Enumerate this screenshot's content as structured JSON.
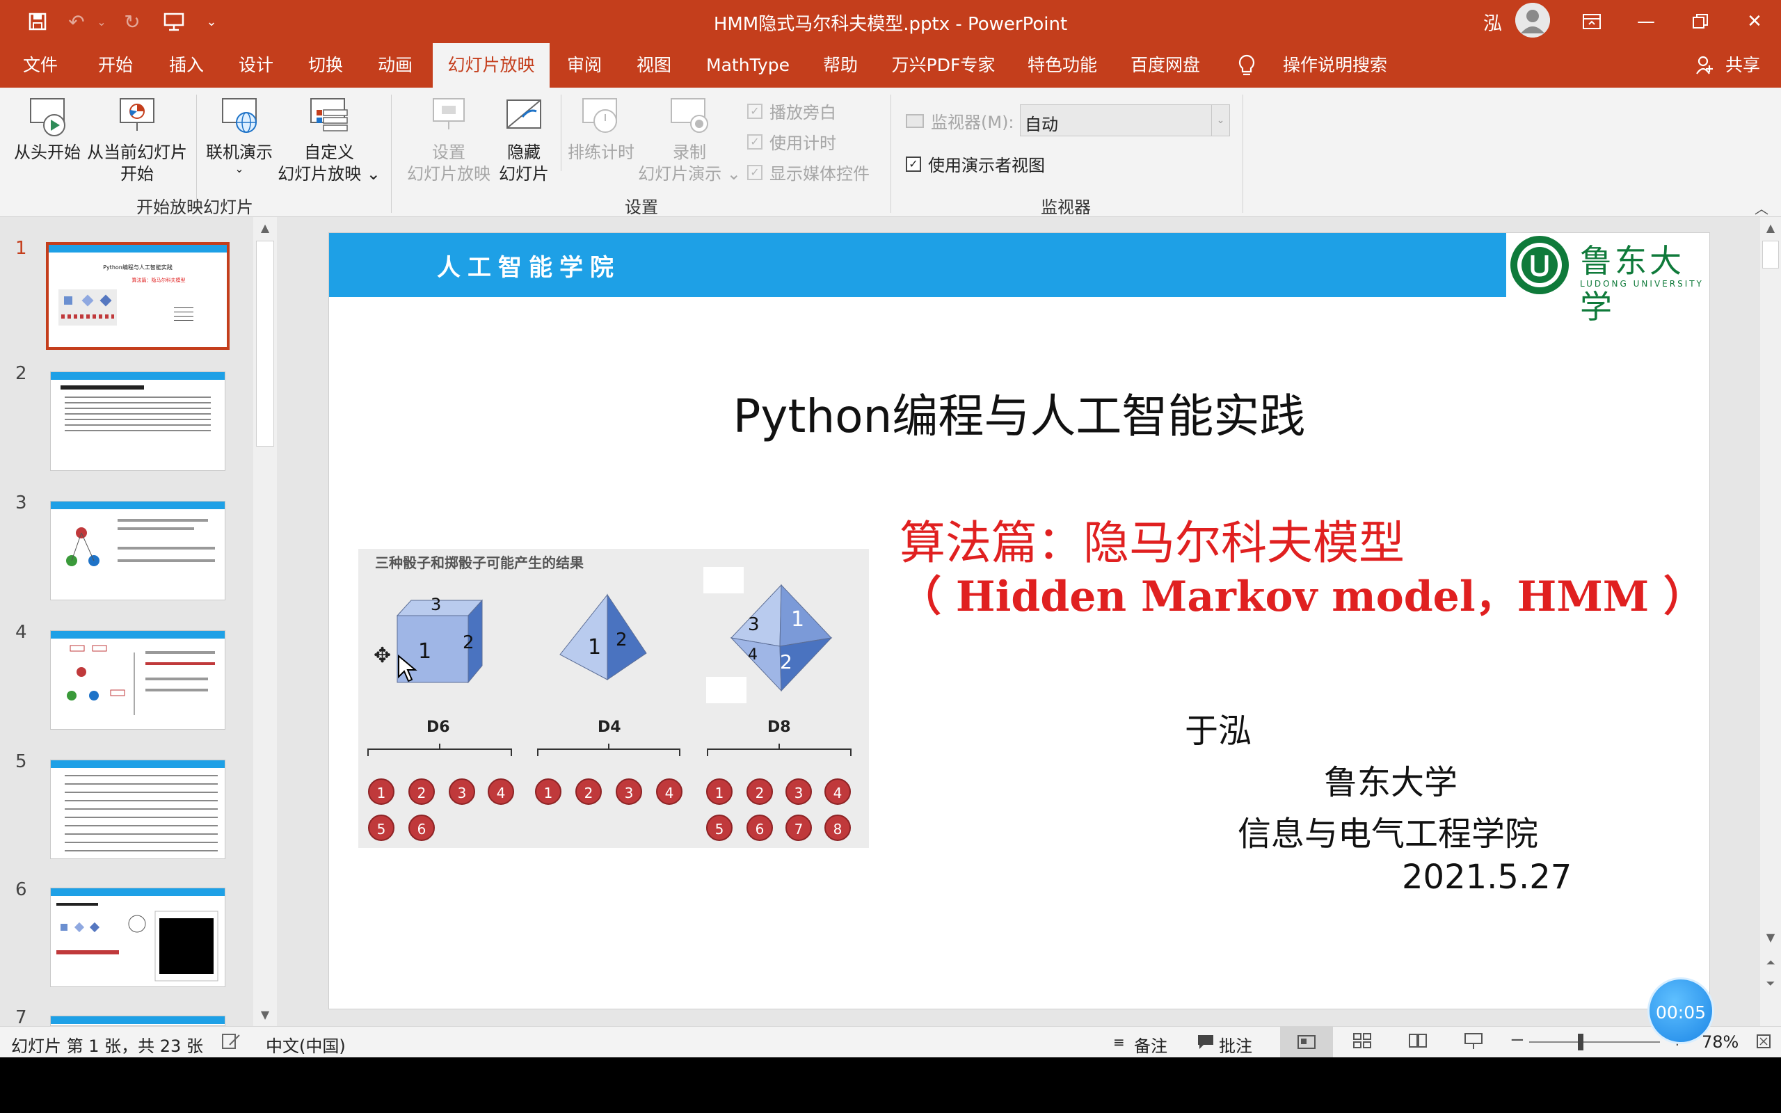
{
  "window": {
    "title": "HMM隐式马尔科夫模型.pptx  -  PowerPoint",
    "user": "泓"
  },
  "tabs": [
    {
      "label": "文件"
    },
    {
      "label": "开始"
    },
    {
      "label": "插入"
    },
    {
      "label": "设计"
    },
    {
      "label": "切换"
    },
    {
      "label": "动画"
    },
    {
      "label": "幻灯片放映",
      "active": true
    },
    {
      "label": "审阅"
    },
    {
      "label": "视图"
    },
    {
      "label": "MathType"
    },
    {
      "label": "帮助"
    },
    {
      "label": "万兴PDF专家"
    },
    {
      "label": "特色功能"
    },
    {
      "label": "百度网盘"
    }
  ],
  "tell_me": "操作说明搜索",
  "share": "共享",
  "ribbon": {
    "start": {
      "from_beginning": "从头开始",
      "from_current_1": "从当前幻灯片",
      "from_current_2": "开始",
      "online_1": "联机演示",
      "online_2": "⌄",
      "custom_1": "自定义",
      "custom_2": "幻灯片放映 ⌄",
      "group": "开始放映幻灯片"
    },
    "setup": {
      "setup_1": "设置",
      "setup_2": "幻灯片放映",
      "hide_1": "隐藏",
      "hide_2": "幻灯片",
      "rehearse": "排练计时",
      "record_1": "录制",
      "record_2": "幻灯片演示 ⌄",
      "play_narrations": "播放旁白",
      "use_timings": "使用计时",
      "show_media_controls": "显示媒体控件",
      "group": "设置"
    },
    "monitors": {
      "monitor_label": "监视器(M):",
      "monitor_value": "自动",
      "presenter_view": "使用演示者视图",
      "group": "监视器"
    }
  },
  "thumbnails": [
    "1",
    "2",
    "3",
    "4",
    "5",
    "6",
    "7"
  ],
  "slide": {
    "college": "人工智能学院",
    "university": "鲁东大学",
    "university_en": "LUDONG UNIVERSITY",
    "title": "Python编程与人工智能实践",
    "subtitle_cn": "算法篇：隐马尔科夫模型",
    "subtitle_en": "（ Hidden Markov model，HMM ）",
    "author": "于泓",
    "affiliation": "鲁东大学",
    "department": "信息与电气工程学院",
    "date": "2021.5.27",
    "dice": {
      "caption": "三种骰子和掷骰子可能产生的结果",
      "d6_label": "D6",
      "d4_label": "D4",
      "d8_label": "D8",
      "d6_faces": [
        "3",
        "1",
        "2"
      ],
      "d4_faces": [
        "1",
        "2"
      ],
      "d8_faces": [
        "3",
        "1",
        "4",
        "2"
      ],
      "d6_outcomes": [
        "1",
        "2",
        "3",
        "4",
        "5",
        "6"
      ],
      "d4_outcomes": [
        "1",
        "2",
        "3",
        "4"
      ],
      "d8_outcomes": [
        "1",
        "2",
        "3",
        "4",
        "5",
        "6",
        "7",
        "8"
      ]
    }
  },
  "status": {
    "slide_info": "幻灯片 第 1 张，共 23 张",
    "language": "中文(中国)",
    "notes": "备注",
    "comments": "批注",
    "zoom": "78%"
  },
  "timer": "00:05"
}
